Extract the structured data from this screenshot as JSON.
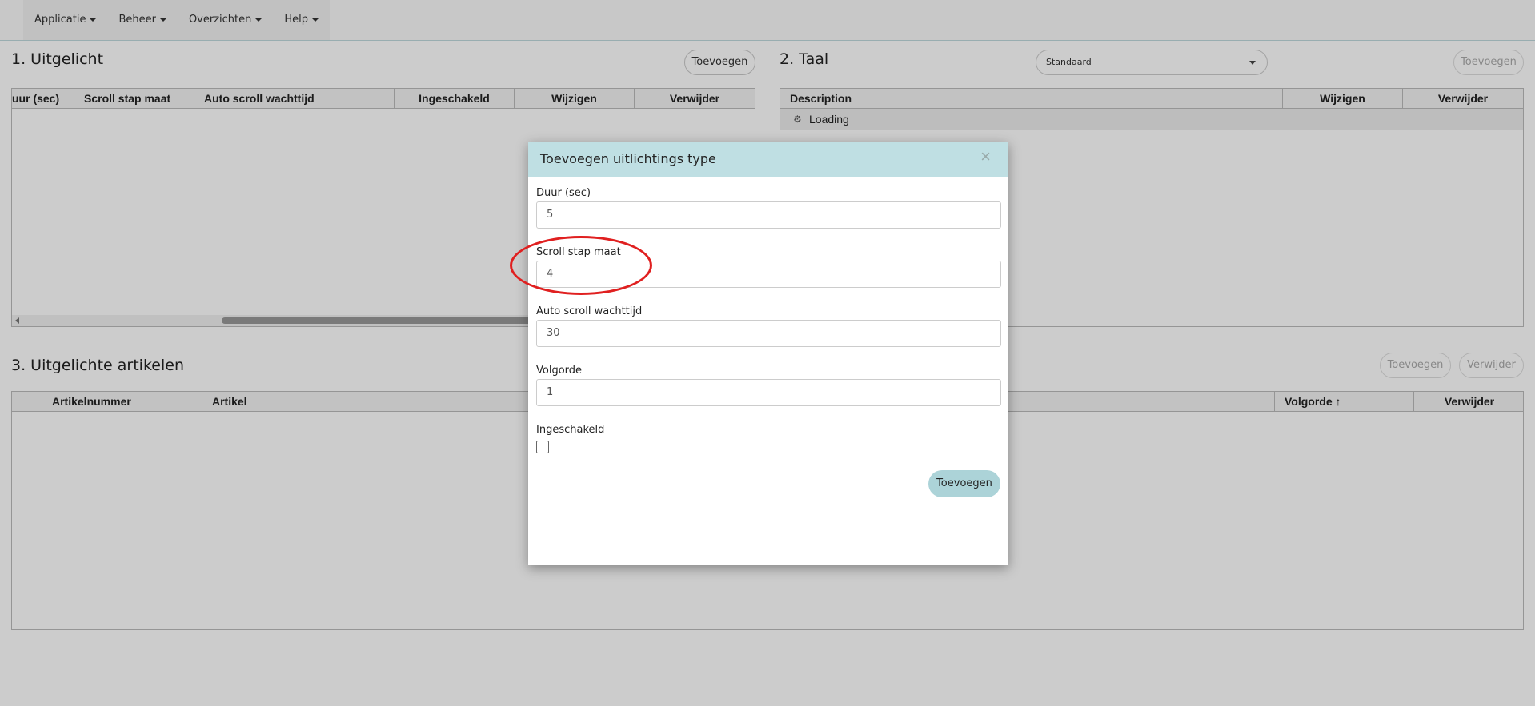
{
  "nav": {
    "items": [
      {
        "label": "Applicatie"
      },
      {
        "label": "Beheer"
      },
      {
        "label": "Overzichten"
      },
      {
        "label": "Help"
      }
    ]
  },
  "panel1": {
    "title": "1. Uitgelicht",
    "add_label": "Toevoegen",
    "columns": [
      "uur (sec)",
      "Scroll stap maat",
      "Auto scroll wachttijd",
      "Ingeschakeld",
      "Wijzigen",
      "Verwijder"
    ]
  },
  "panel2": {
    "title": "2. Taal",
    "select_value": "Standaard",
    "add_label": "Toevoegen",
    "columns": [
      "Description",
      "Wijzigen",
      "Verwijder"
    ],
    "loading_text": "Loading"
  },
  "panel3": {
    "title": "3. Uitgelichte artikelen",
    "add_label": "Toevoegen",
    "delete_label": "Verwijder",
    "columns": [
      "Artikelnummer",
      "Artikel",
      "Volgorde ↑",
      "Verwijder"
    ]
  },
  "modal": {
    "title": "Toevoegen uitlichtings type",
    "close": "×",
    "fields": [
      {
        "label": "Duur (sec)",
        "value": "5"
      },
      {
        "label": "Scroll stap maat",
        "value": "4"
      },
      {
        "label": "Auto scroll wachttijd",
        "value": "30"
      },
      {
        "label": "Volgorde",
        "value": "1"
      }
    ],
    "checkbox_label": "Ingeschakeld",
    "checkbox_checked": false,
    "submit_label": "Toevoegen"
  },
  "colors": {
    "accent": "#acd3d8",
    "header": "#bfdfe3",
    "annotation": "#e02020"
  }
}
